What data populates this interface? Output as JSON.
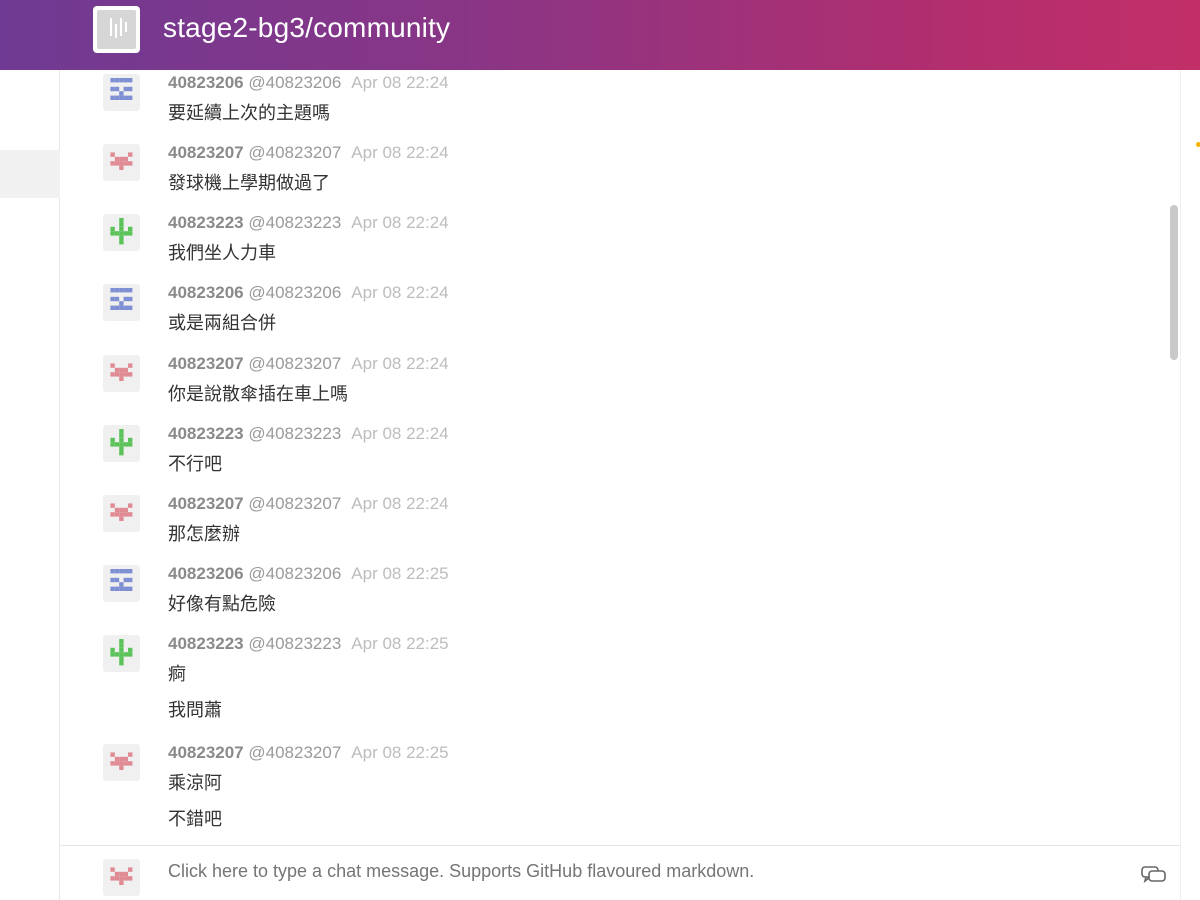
{
  "room": {
    "title": "stage2-bg3/community",
    "avatar_icon": "room-avatar-icon"
  },
  "messages": [
    {
      "name": "40823206",
      "handle": "@40823206",
      "time": "Apr 08 22:24",
      "avatar": "blue",
      "lines": [
        "要延續上次的主題嗎"
      ]
    },
    {
      "name": "40823207",
      "handle": "@40823207",
      "time": "Apr 08 22:24",
      "avatar": "red",
      "lines": [
        "發球機上學期做過了"
      ]
    },
    {
      "name": "40823223",
      "handle": "@40823223",
      "time": "Apr 08 22:24",
      "avatar": "green",
      "lines": [
        "我們坐人力車"
      ]
    },
    {
      "name": "40823206",
      "handle": "@40823206",
      "time": "Apr 08 22:24",
      "avatar": "blue",
      "lines": [
        "或是兩組合併"
      ]
    },
    {
      "name": "40823207",
      "handle": "@40823207",
      "time": "Apr 08 22:24",
      "avatar": "red",
      "lines": [
        "你是說散傘插在車上嗎"
      ]
    },
    {
      "name": "40823223",
      "handle": "@40823223",
      "time": "Apr 08 22:24",
      "avatar": "green",
      "lines": [
        "不行吧"
      ]
    },
    {
      "name": "40823207",
      "handle": "@40823207",
      "time": "Apr 08 22:24",
      "avatar": "red",
      "lines": [
        "那怎麼辦"
      ]
    },
    {
      "name": "40823206",
      "handle": "@40823206",
      "time": "Apr 08 22:25",
      "avatar": "blue",
      "lines": [
        "好像有點危險"
      ]
    },
    {
      "name": "40823223",
      "handle": "@40823223",
      "time": "Apr 08 22:25",
      "avatar": "green",
      "lines": [
        "痾",
        "我問蕭"
      ]
    },
    {
      "name": "40823207",
      "handle": "@40823207",
      "time": "Apr 08 22:25",
      "avatar": "red",
      "lines": [
        "乘涼阿",
        "不錯吧"
      ]
    }
  ],
  "composer": {
    "placeholder": "Click here to type a chat message. Supports GitHub flavoured markdown.",
    "icon": "chat-bubbles-icon"
  },
  "colors": {
    "blue": "#7f8fd4",
    "red": "#e08a93",
    "green": "#5cc25a"
  }
}
